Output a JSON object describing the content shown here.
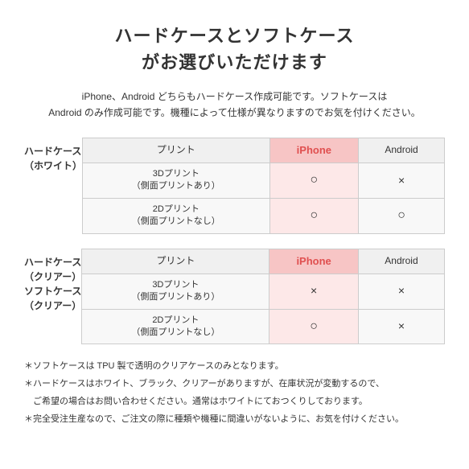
{
  "title": {
    "line1": "ハードケースとソフトケース",
    "line2": "がお選びいただけます"
  },
  "description": "iPhone、Android どちらもハードケース作成可能です。ソフトケースは\nAndroid のみ作成可能です。機種によって仕様が異なりますのでお気を付けください。",
  "section1": {
    "row_header_line1": "ハードケース",
    "row_header_line2": "（ホワイト）",
    "col_print": "プリント",
    "col_iphone": "iPhone",
    "col_android": "Android",
    "row1_print": "3Dプリント\n（側面プリントあり）",
    "row1_iphone": "○",
    "row1_android": "×",
    "row2_print": "2Dプリント\n（側面プリントなし）",
    "row2_iphone": "○",
    "row2_android": "○"
  },
  "section2": {
    "row_header_line1a": "ハードケース",
    "row_header_line2a": "（クリアー）",
    "row_header_line1b": "ソフトケース",
    "row_header_line2b": "（クリアー）",
    "col_print": "プリント",
    "col_iphone": "iPhone",
    "col_android": "Android",
    "row1_print": "3Dプリント\n（側面プリントあり）",
    "row1_iphone": "×",
    "row1_android": "×",
    "row2_print": "2Dプリント\n（側面プリントなし）",
    "row2_iphone": "○",
    "row2_android": "×"
  },
  "notes": {
    "note1": "＊ソフトケースは TPU 製で透明のクリアケースのみとなります。",
    "note2": "＊ハードケースはホワイト、ブラック、クリアーがありますが、在庫状況が変動するので、",
    "note2b": "　ご希望の場合はお問い合わせください。通常はホワイトにておつくりしております。",
    "note3": "＊完全受注生産なので、ご注文の際に種類や機種に間違いがないように、お気を付けください。"
  }
}
